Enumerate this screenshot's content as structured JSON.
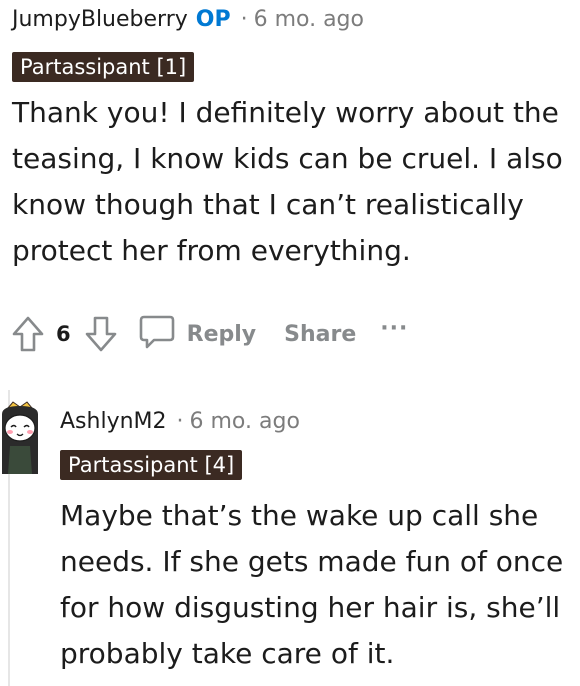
{
  "comment1": {
    "username": "JumpyBlueberry",
    "op_badge": "OP",
    "separator": "·",
    "time": "6 mo. ago",
    "flair": "Partassipant [1]",
    "body": "Thank you! I definitely worry about the teasing, I know kids can be cruel. I also know though that I can’t realistically protect her from everything.",
    "actions": {
      "upvote_icon": "upvote-arrow-icon",
      "vote_count": "6",
      "downvote_icon": "downvote-arrow-icon",
      "reply_icon": "speech-bubble-icon",
      "reply_label": "Reply",
      "share_label": "Share",
      "more_label": "···"
    }
  },
  "comment2": {
    "username": "AshlynM2",
    "separator": "·",
    "time": "6 mo. ago",
    "flair": "Partassipant [4]",
    "avatar_icon": "snoo-avatar",
    "body": "Maybe that’s the wake up call she needs. If she gets made fun of once for how disgusting her hair is, she’ll probably take care of it."
  },
  "colors": {
    "op_blue": "#0079d3",
    "flair_bg": "#3b2a22",
    "muted_gray": "#878a8c",
    "time_gray": "#7c7c7c",
    "thread_line": "#e6e6e6"
  }
}
